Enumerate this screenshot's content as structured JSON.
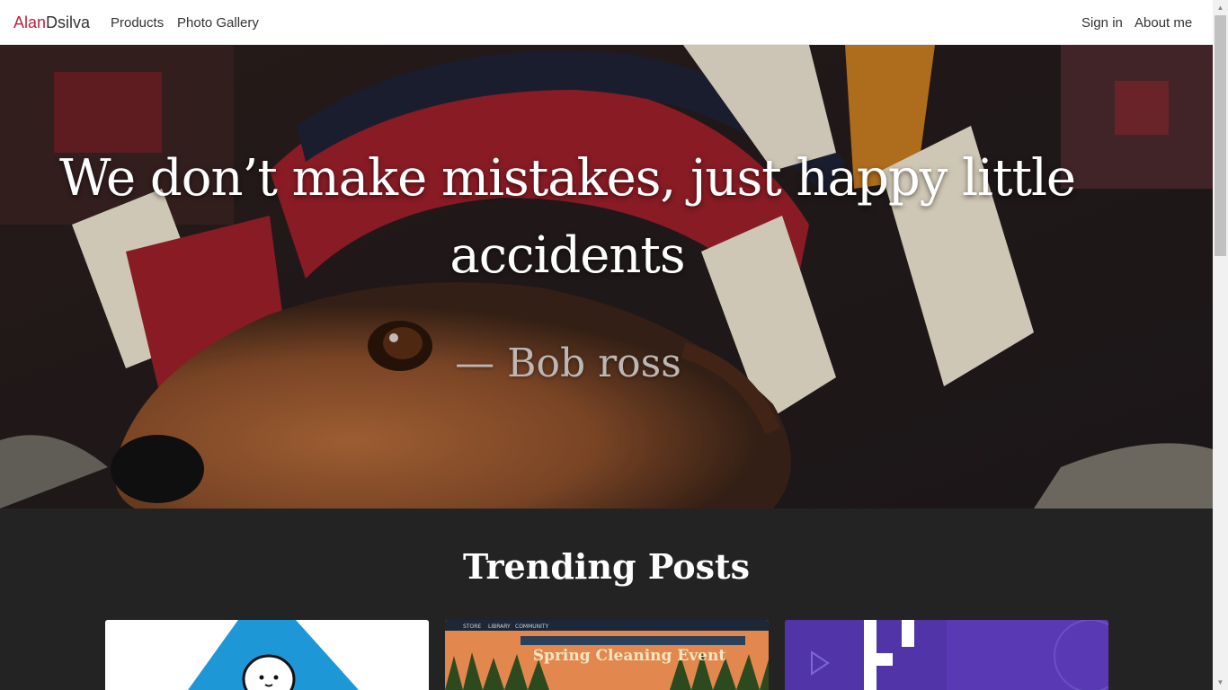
{
  "navbar": {
    "brand_first": "Alan",
    "brand_last": "Dsilva",
    "links_left": [
      "Products",
      "Photo Gallery"
    ],
    "links_right": [
      "Sign in",
      "About me"
    ]
  },
  "hero": {
    "quote": "We don’t make mistakes, just happy little accidents",
    "author": "— Bob ross"
  },
  "trending": {
    "title": "Trending Posts",
    "cards": [
      {
        "image": "triangle-character-illustration"
      },
      {
        "image": "spring-cleaning-event-screenshot",
        "caption": "Spring Cleaning Event",
        "store_tabs": [
          "STORE",
          "LIBRARY",
          "COMMUNITY"
        ]
      },
      {
        "image": "logo-illustration"
      }
    ]
  },
  "colors": {
    "brand_accent": "#b8253a",
    "navbar_bg": "#ffffff",
    "section_bg": "#232323",
    "card2_bg": "#e2884e",
    "card3_bg": "#5b3bb4"
  }
}
